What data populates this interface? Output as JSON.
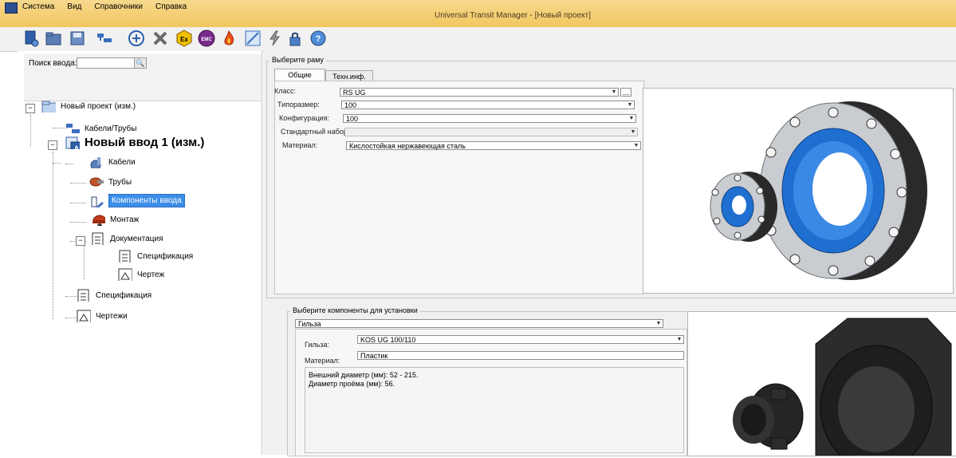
{
  "app": {
    "title": "Universal Transit Manager - [Новый проект]"
  },
  "menu": {
    "items": [
      "Система",
      "Вид",
      "Справочники",
      "Справка"
    ]
  },
  "toolbar": {
    "icons": [
      "new-project",
      "open",
      "save",
      "cables",
      "add",
      "delete",
      "ex",
      "emc",
      "fire",
      "calc",
      "lightning",
      "lock",
      "help"
    ],
    "ex_label": "Ex",
    "emc_label": "EMC",
    "help_label": "?"
  },
  "search": {
    "label": "Поиск ввода:",
    "value": "",
    "button": "🔍"
  },
  "tree": {
    "project": "Новый проект (изм.)",
    "cables_pipes": "Кабели/Трубы",
    "entry": "Новый ввод 1 (изм.)",
    "cables": "Кабели",
    "pipes": "Трубы",
    "components": "Компоненты ввода",
    "mounting": "Монтаж",
    "documentation": "Документация",
    "doc_spec": "Спецификация",
    "doc_drawing": "Чертеж",
    "spec": "Спецификация",
    "drawings": "Чертежи",
    "collapse": "−"
  },
  "frame": {
    "group_label": "Выберите раму",
    "tabs": [
      "Общие",
      "Техн.инф."
    ],
    "fields": [
      {
        "label": "Класс:",
        "value": "RS UG"
      },
      {
        "label": "Типоразмер:",
        "value": "100"
      },
      {
        "label": "Конфигурация:",
        "value": "100"
      },
      {
        "label": "Стандартный набор:",
        "value": ""
      },
      {
        "label": "Материал:",
        "value": "Кислостойкая нержавеющая сталь"
      }
    ],
    "browse": "..."
  },
  "components": {
    "group_label": "Выберите компоненты для установки",
    "type_value": "Гильза",
    "fields": [
      {
        "label": "Гильза:",
        "value": "KOS UG 100/110"
      },
      {
        "label": "Материал:",
        "value": "Пластик"
      }
    ],
    "notes": [
      "Внешний диаметр (мм): 52 - 215.",
      "Диаметр проёма (мм): 56."
    ]
  },
  "colors": {
    "titlebar": "#f2c65f",
    "selection": "#3c8ee8",
    "flange_blue": "#1f6fd1"
  }
}
